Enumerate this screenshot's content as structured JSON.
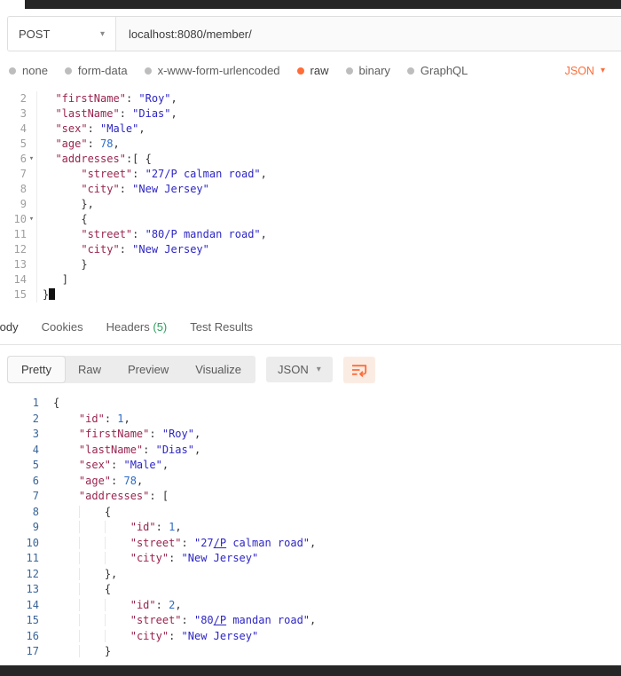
{
  "colors": {
    "accent": "#ff6c37",
    "key": "#99244f",
    "string": "#2d26c4",
    "number": "#2d6bc4",
    "punctuation": "#333333",
    "request_line_numbers": "#9e9e9e",
    "response_line_numbers": "#3a6598",
    "headers_count_green": "#2f9e5f"
  },
  "request": {
    "method": "POST",
    "url": "localhost:8080/member/",
    "body_types": [
      {
        "label": "none",
        "selected": false
      },
      {
        "label": "form-data",
        "selected": false
      },
      {
        "label": "x-www-form-urlencoded",
        "selected": false
      },
      {
        "label": "raw",
        "selected": true
      },
      {
        "label": "binary",
        "selected": false
      },
      {
        "label": "GraphQL",
        "selected": false
      }
    ],
    "raw_language": "JSON",
    "editor_lines": [
      {
        "n": 2,
        "t": [
          [
            "ws",
            "  "
          ],
          [
            "key",
            "\"firstName\""
          ],
          [
            "pun",
            ": "
          ],
          [
            "str",
            "\"Roy\""
          ],
          [
            "pun",
            ","
          ]
        ]
      },
      {
        "n": 3,
        "t": [
          [
            "ws",
            "  "
          ],
          [
            "key",
            "\"lastName\""
          ],
          [
            "pun",
            ": "
          ],
          [
            "str",
            "\"Dias\""
          ],
          [
            "pun",
            ","
          ]
        ]
      },
      {
        "n": 4,
        "t": [
          [
            "ws",
            "  "
          ],
          [
            "key",
            "\"sex\""
          ],
          [
            "pun",
            ": "
          ],
          [
            "str",
            "\"Male\""
          ],
          [
            "pun",
            ","
          ]
        ]
      },
      {
        "n": 5,
        "t": [
          [
            "ws",
            "  "
          ],
          [
            "key",
            "\"age\""
          ],
          [
            "pun",
            ": "
          ],
          [
            "num",
            "78"
          ],
          [
            "pun",
            ","
          ]
        ]
      },
      {
        "n": 6,
        "fold": true,
        "t": [
          [
            "ws",
            "  "
          ],
          [
            "key",
            "\"addresses\""
          ],
          [
            "pun",
            ":[ {"
          ]
        ]
      },
      {
        "n": 7,
        "t": [
          [
            "ws",
            "      "
          ],
          [
            "key",
            "\"street\""
          ],
          [
            "pun",
            ": "
          ],
          [
            "str",
            "\"27/P calman road\""
          ],
          [
            "pun",
            ","
          ]
        ]
      },
      {
        "n": 8,
        "t": [
          [
            "ws",
            "      "
          ],
          [
            "key",
            "\"city\""
          ],
          [
            "pun",
            ": "
          ],
          [
            "str",
            "\"New Jersey\""
          ]
        ]
      },
      {
        "n": 9,
        "t": [
          [
            "ws",
            "      "
          ],
          [
            "pun",
            "},"
          ]
        ]
      },
      {
        "n": 10,
        "fold": true,
        "t": [
          [
            "ws",
            "      "
          ],
          [
            "pun",
            "{"
          ]
        ]
      },
      {
        "n": 11,
        "t": [
          [
            "ws",
            "      "
          ],
          [
            "key",
            "\"street\""
          ],
          [
            "pun",
            ": "
          ],
          [
            "str",
            "\"80/P mandan road\""
          ],
          [
            "pun",
            ","
          ]
        ]
      },
      {
        "n": 12,
        "t": [
          [
            "ws",
            "      "
          ],
          [
            "key",
            "\"city\""
          ],
          [
            "pun",
            ": "
          ],
          [
            "str",
            "\"New Jersey\""
          ]
        ]
      },
      {
        "n": 13,
        "t": [
          [
            "ws",
            "      "
          ],
          [
            "pun",
            "}"
          ]
        ]
      },
      {
        "n": 14,
        "t": [
          [
            "ws",
            "   "
          ],
          [
            "pun",
            "]"
          ]
        ]
      },
      {
        "n": 15,
        "t": [
          [
            "pun",
            "}"
          ],
          [
            "cur",
            ""
          ]
        ]
      }
    ]
  },
  "response": {
    "tabs": [
      {
        "label": "Body",
        "selected": true
      },
      {
        "label": "Cookies",
        "selected": false
      },
      {
        "label": "Headers",
        "badge": "(5)",
        "selected": false
      },
      {
        "label": "Test Results",
        "selected": false
      }
    ],
    "view_modes": [
      {
        "label": "Pretty",
        "selected": true
      },
      {
        "label": "Raw",
        "selected": false
      },
      {
        "label": "Preview",
        "selected": false
      },
      {
        "label": "Visualize",
        "selected": false
      }
    ],
    "format": "JSON",
    "body_lines": [
      {
        "n": 1,
        "t": [
          [
            "pun",
            "{"
          ]
        ]
      },
      {
        "n": 2,
        "t": [
          [
            "ws",
            "    "
          ],
          [
            "key",
            "\"id\""
          ],
          [
            "pun",
            ": "
          ],
          [
            "num",
            "1"
          ],
          [
            "pun",
            ","
          ]
        ]
      },
      {
        "n": 3,
        "t": [
          [
            "ws",
            "    "
          ],
          [
            "key",
            "\"firstName\""
          ],
          [
            "pun",
            ": "
          ],
          [
            "str",
            "\"Roy\""
          ],
          [
            "pun",
            ","
          ]
        ]
      },
      {
        "n": 4,
        "t": [
          [
            "ws",
            "    "
          ],
          [
            "key",
            "\"lastName\""
          ],
          [
            "pun",
            ": "
          ],
          [
            "str",
            "\"Dias\""
          ],
          [
            "pun",
            ","
          ]
        ]
      },
      {
        "n": 5,
        "t": [
          [
            "ws",
            "    "
          ],
          [
            "key",
            "\"sex\""
          ],
          [
            "pun",
            ": "
          ],
          [
            "str",
            "\"Male\""
          ],
          [
            "pun",
            ","
          ]
        ]
      },
      {
        "n": 6,
        "t": [
          [
            "ws",
            "    "
          ],
          [
            "key",
            "\"age\""
          ],
          [
            "pun",
            ": "
          ],
          [
            "num",
            "78"
          ],
          [
            "pun",
            ","
          ]
        ]
      },
      {
        "n": 7,
        "t": [
          [
            "ws",
            "    "
          ],
          [
            "key",
            "\"addresses\""
          ],
          [
            "pun",
            ": ["
          ]
        ]
      },
      {
        "n": 8,
        "t": [
          [
            "ws",
            "        "
          ],
          [
            "pun",
            "{"
          ]
        ]
      },
      {
        "n": 9,
        "t": [
          [
            "ws",
            "            "
          ],
          [
            "key",
            "\"id\""
          ],
          [
            "pun",
            ": "
          ],
          [
            "num",
            "1"
          ],
          [
            "pun",
            ","
          ]
        ]
      },
      {
        "n": 10,
        "t": [
          [
            "ws",
            "            "
          ],
          [
            "key",
            "\"street\""
          ],
          [
            "pun",
            ": "
          ],
          [
            "str",
            "\"27"
          ],
          [
            "stru",
            "/P"
          ],
          [
            "str",
            " calman road\""
          ],
          [
            "pun",
            ","
          ]
        ]
      },
      {
        "n": 11,
        "t": [
          [
            "ws",
            "            "
          ],
          [
            "key",
            "\"city\""
          ],
          [
            "pun",
            ": "
          ],
          [
            "str",
            "\"New Jersey\""
          ]
        ]
      },
      {
        "n": 12,
        "t": [
          [
            "ws",
            "        "
          ],
          [
            "pun",
            "},"
          ]
        ]
      },
      {
        "n": 13,
        "t": [
          [
            "ws",
            "        "
          ],
          [
            "pun",
            "{"
          ]
        ]
      },
      {
        "n": 14,
        "t": [
          [
            "ws",
            "            "
          ],
          [
            "key",
            "\"id\""
          ],
          [
            "pun",
            ": "
          ],
          [
            "num",
            "2"
          ],
          [
            "pun",
            ","
          ]
        ]
      },
      {
        "n": 15,
        "t": [
          [
            "ws",
            "            "
          ],
          [
            "key",
            "\"street\""
          ],
          [
            "pun",
            ": "
          ],
          [
            "str",
            "\"80"
          ],
          [
            "stru",
            "/P"
          ],
          [
            "str",
            " mandan road\""
          ],
          [
            "pun",
            ","
          ]
        ]
      },
      {
        "n": 16,
        "t": [
          [
            "ws",
            "            "
          ],
          [
            "key",
            "\"city\""
          ],
          [
            "pun",
            ": "
          ],
          [
            "str",
            "\"New Jersey\""
          ]
        ]
      },
      {
        "n": 17,
        "t": [
          [
            "ws",
            "        "
          ],
          [
            "pun",
            "}"
          ]
        ]
      }
    ]
  }
}
